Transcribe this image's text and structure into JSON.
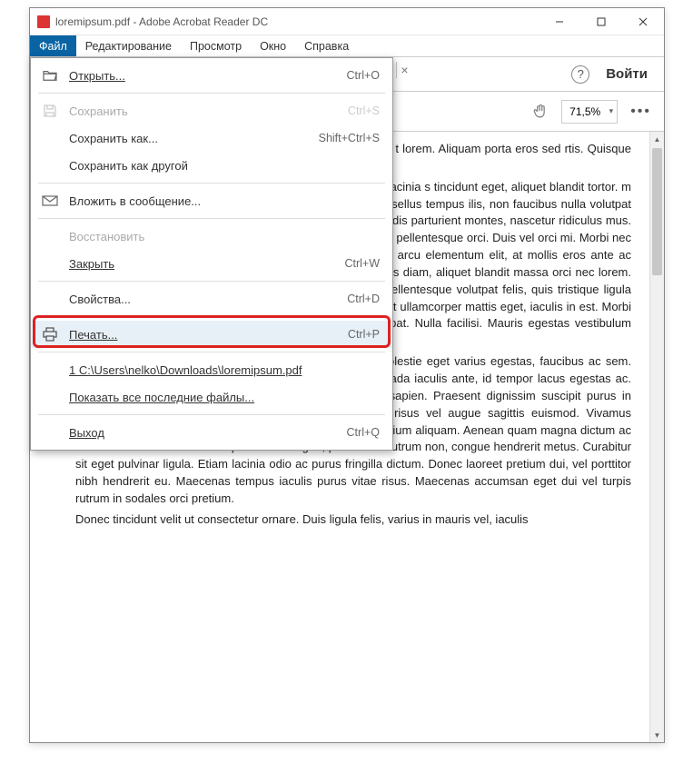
{
  "title": "loremipsum.pdf - Adobe Acrobat Reader DC",
  "menubar": [
    "Файл",
    "Редактирование",
    "Просмотр",
    "Окно",
    "Справка"
  ],
  "toolbar": {
    "signin": "Войти",
    "zoom": "71,5%"
  },
  "dropdown": {
    "open": {
      "label": "Открыть...",
      "shortcut": "Ctrl+O"
    },
    "save": {
      "label": "Сохранить",
      "shortcut": "Ctrl+S"
    },
    "save_as": {
      "label": "Сохранить как...",
      "shortcut": "Shift+Ctrl+S"
    },
    "save_other": {
      "label": "Сохранить как другой"
    },
    "attach": {
      "label": "Вложить в сообщение..."
    },
    "revert": {
      "label": "Восстановить"
    },
    "close": {
      "label": "Закрыть",
      "shortcut": "Ctrl+W"
    },
    "props": {
      "label": "Свойства...",
      "shortcut": "Ctrl+D"
    },
    "print": {
      "label": "Печать...",
      "shortcut": "Ctrl+P"
    },
    "recent1": {
      "label": "1 C:\\Users\\nelko\\Downloads\\loremipsum.pdf"
    },
    "show_recent": {
      "label": "Показать все последние файлы..."
    },
    "exit": {
      "label": "Выход",
      "shortcut": "Ctrl+Q"
    }
  },
  "document": {
    "p1": "illa est purus, ultrices in porttitor is. Curabitur vitae id feugiat t lorem. Aliquam porta eros sed rtis. Quisque imperdiet ipsum vel ibus netus malesuada turpis varius id.",
    "p2": "n, blandit metus, ac posuere lorem e, vehicula eu dui. Duis lacinia s tincidunt eget, aliquet blandit tortor. m elit congue porta. Vivamus viverra is ullamcorper diam. Phasellus tempus ilis, non faucibus nulla volutpat finibus. Nascetur ridiculus mus. atoque penatibus et magnis dis parturient montes, nascetur ridiculus mus. Vestibulum varius ipsum arcu semper adipiscing elit. Nunc id pellentesque orci. Duis vel orci mi. Morbi nec rhoncus. Integer mattis, ipsum a tincidunt commodo, lacus arcu elementum elit, at mollis eros ante ac nunc. In volutpat, ante at pretium dictum, velit magna sagittis diam, aliquet blandit massa orci nec lorem. Nulla facilisi. Duis vehicula arcu. Nulla facilisi. Maecenas pellentesque volutpat felis, quis tristique ligula luctus ut. Sed nec mi eros. Integer augue sapien, dignissim it ullamcorper mattis eget, iaculis in est. Morbi sollicitudin libero at enim gravida, at consectetur dui volutpat. Nulla facilisi. Mauris egestas vestibulum neque cursus tincidunt.",
    "p3": "Quisque volutpat pharetra tincidunt. Fusce sapien arcu, molestie eget varius egestas, faucibus ac sem. Sed ut dui in velit lobortis egestas ut a felis. Etiam malesuada iaculis ante, id tempor lacus egestas ac. Nam vehicula nibh lectus, gravida diam sit, feugiat quis sapien. Praesent dignissim suscipit purus in elementum. Donec malesuada lorem. Phasellus ultricies risus vel augue sagittis euismod. Vivamus tincidunt placerat nisi in aliquam. Cras quis mi nec nulla pretium aliquam. Aenean quam magna dictum ac metus commodo rhoncus. Aliquam nulla augue, porta vitae rutrum non, congue hendrerit metus. Curabitur sit eget pulvinar ligula. Etiam lacinia odio ac purus fringilla dictum. Donec laoreet pretium dui, vel porttitor nibh hendrerit eu. Maecenas tempus iaculis purus vitae risus. Maecenas accumsan eget dui vel turpis rutrum in sodales orci pretium.",
    "p4": "Donec tincidunt velit ut consectetur ornare. Duis ligula felis, varius in mauris vel, iaculis"
  }
}
